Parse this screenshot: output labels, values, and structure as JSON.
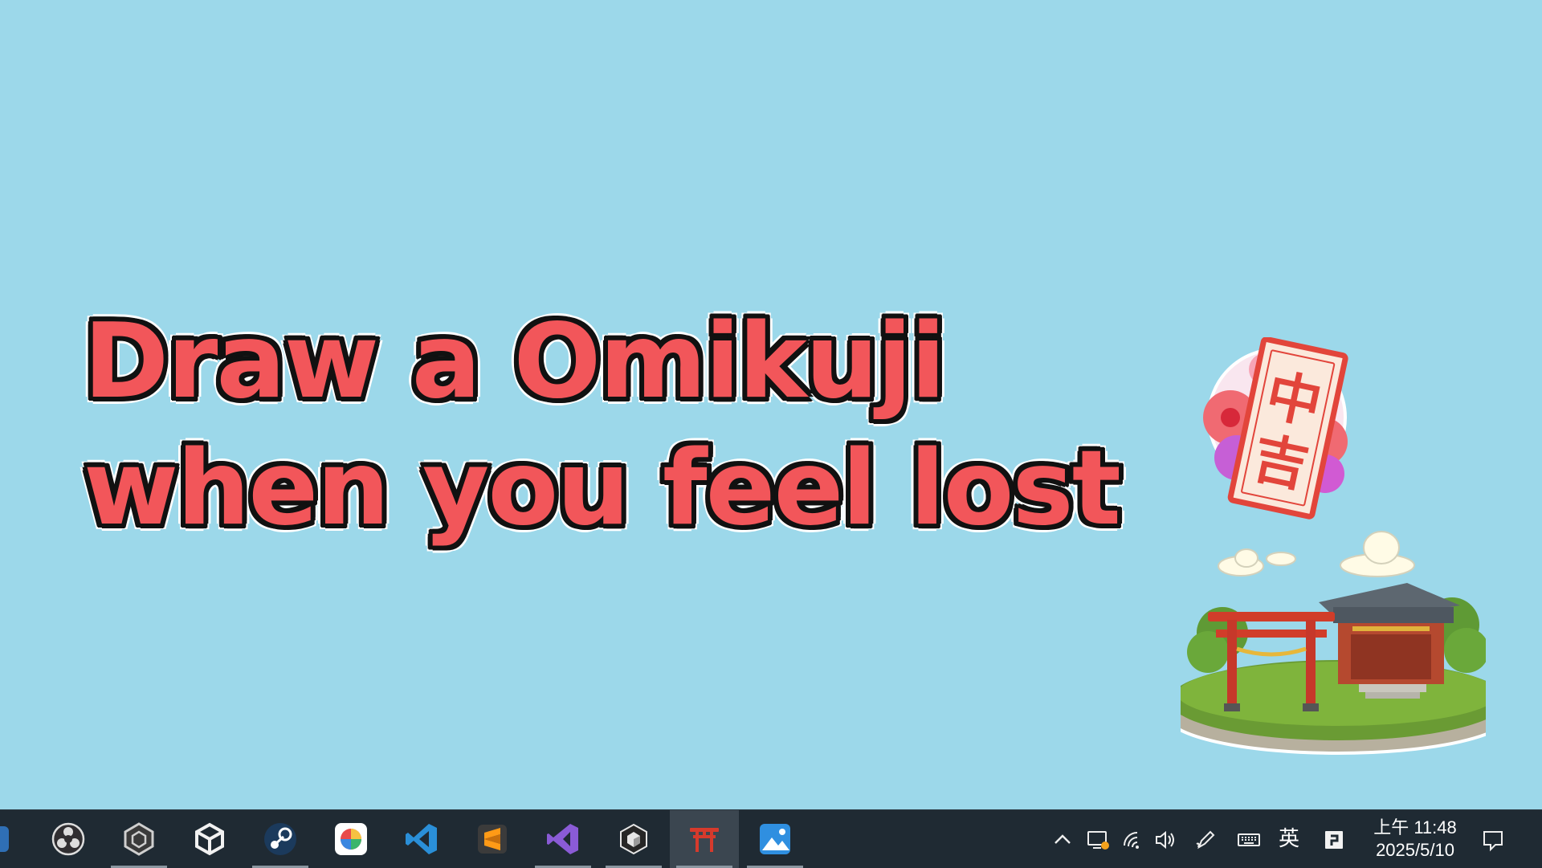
{
  "desktop": {
    "background": "#9cd8ea",
    "headline": {
      "line1": "Draw a Omikuji",
      "line2": "when you feel lost",
      "color": "#f2565a"
    },
    "omikuji_slip": {
      "char_top": "中",
      "char_bottom": "吉"
    }
  },
  "taskbar": {
    "apps": [
      {
        "name": "edge-app",
        "icon": "edge-icon"
      },
      {
        "name": "obs-studio",
        "icon": "obs-icon"
      },
      {
        "name": "unity-hub",
        "icon": "unity-hub-icon"
      },
      {
        "name": "unity-editor",
        "icon": "unity-icon"
      },
      {
        "name": "steam",
        "icon": "steam-icon"
      },
      {
        "name": "color-picker",
        "icon": "color-wheel-icon"
      },
      {
        "name": "vs-code",
        "icon": "vscode-icon"
      },
      {
        "name": "sublime-text",
        "icon": "sublime-icon"
      },
      {
        "name": "visual-studio",
        "icon": "visual-studio-icon"
      },
      {
        "name": "unity-package",
        "icon": "unity-cube-icon"
      },
      {
        "name": "omikuji-app",
        "icon": "torii-icon",
        "active": true
      },
      {
        "name": "photos",
        "icon": "photos-icon"
      }
    ],
    "tray": {
      "ime_label": "英",
      "time": "上午 11:48",
      "date": "2025/5/10"
    }
  }
}
